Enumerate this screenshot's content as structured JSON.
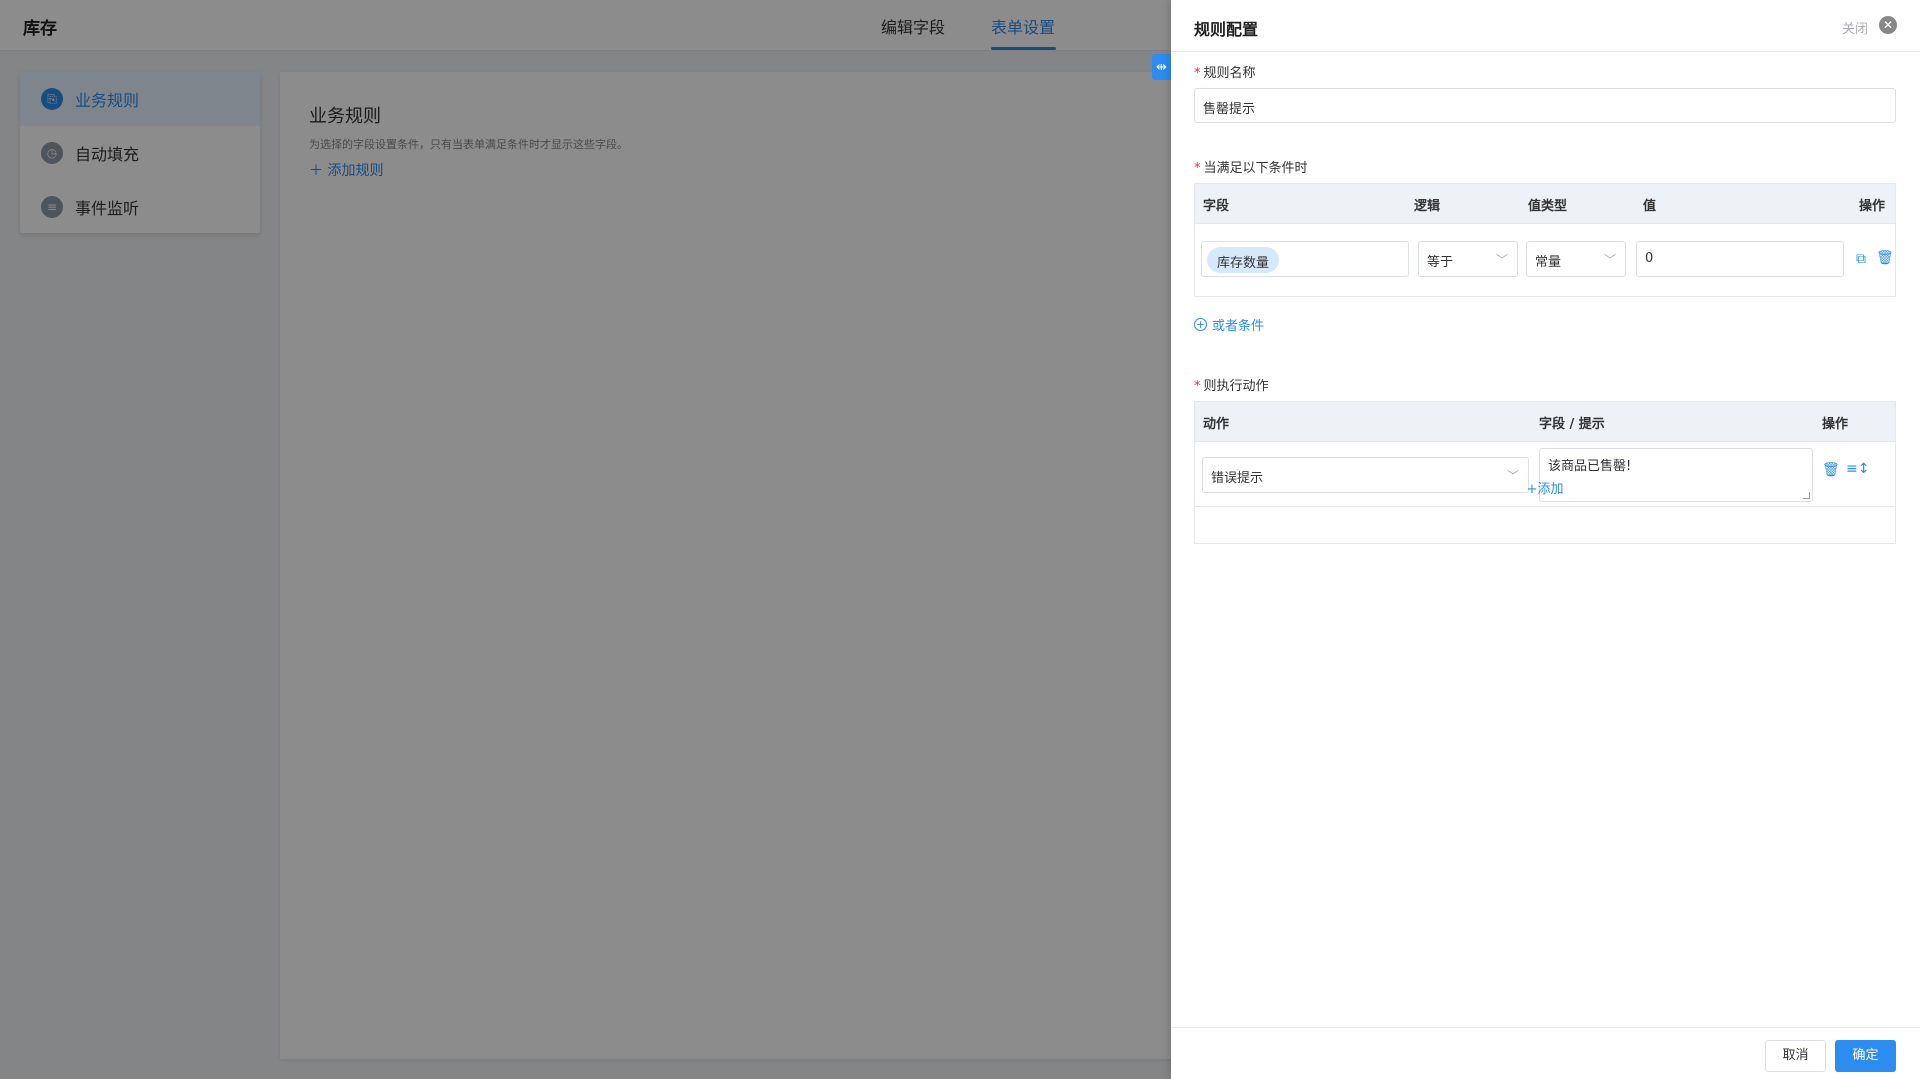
{
  "app": {
    "title": "库存"
  },
  "top_tabs": [
    {
      "label": "编辑字段",
      "active": false
    },
    {
      "label": "表单设置",
      "active": true
    }
  ],
  "side_menu": {
    "items": [
      {
        "label": "业务规则",
        "icon": "rule-icon",
        "active": true
      },
      {
        "label": "自动填充",
        "icon": "autofill-icon",
        "active": false
      },
      {
        "label": "事件监听",
        "icon": "event-icon",
        "active": false
      }
    ]
  },
  "content": {
    "title": "业务规则",
    "description": "为选择的字段设置条件，只有当表单满足条件时才显示这些字段。",
    "add_rule": "添加规则"
  },
  "drawer": {
    "title": "规则配置",
    "close_label": "关闭",
    "rule_name": {
      "label": "规则名称",
      "value": "售罄提示"
    },
    "conditions": {
      "label": "当满足以下条件时",
      "headers": {
        "field": "字段",
        "logic": "逻辑",
        "value_type": "值类型",
        "value": "值",
        "ops": "操作"
      },
      "row": {
        "field_tag": "库存数量",
        "logic": "等于",
        "value_type": "常量",
        "value": "0"
      },
      "or_condition": "或者条件"
    },
    "actions": {
      "label": "则执行动作",
      "headers": {
        "action": "动作",
        "field_hint": "字段 / 提示",
        "ops": "操作"
      },
      "row": {
        "action": "错误提示",
        "hint": "该商品已售罄!"
      },
      "add": "+添加"
    },
    "footer": {
      "cancel": "取消",
      "confirm": "确定"
    }
  },
  "colors": {
    "accent": "#2d8cf0",
    "required": "#f5222d"
  }
}
